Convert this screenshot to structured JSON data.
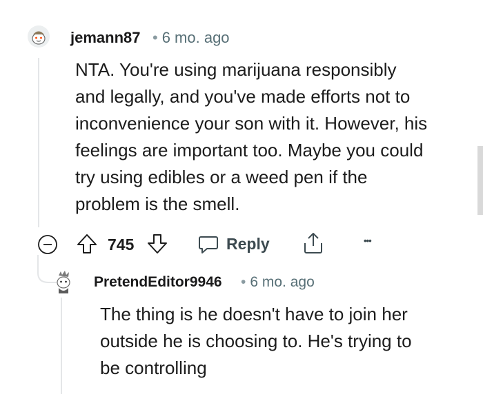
{
  "comments": [
    {
      "username": "jemann87",
      "time": "6 mo. ago",
      "body": [
        "NTA. You're using marijuana responsibly",
        "and legally, and you've made efforts not to",
        "inconvenience your son with it. However, his",
        "feelings are important too. Maybe you could",
        "try using edibles or a weed pen if the",
        "problem is the smell."
      ],
      "votes": "745",
      "reply_label": "Reply",
      "more_label": "•••"
    },
    {
      "username": "PretendEditor9946",
      "time": "6 mo. ago",
      "body": [
        "The thing is he doesn't have to join her",
        "outside he is choosing to. He's trying to",
        "be controlling"
      ]
    }
  ],
  "separator": "•",
  "icons": {
    "collapse": "collapse-icon",
    "upvote": "upvote-icon",
    "downvote": "downvote-icon",
    "reply": "comment-icon",
    "share": "share-icon"
  },
  "colors": {
    "text": "#1c1c1c",
    "meta": "#576f76",
    "thread": "#e4e6e8"
  }
}
